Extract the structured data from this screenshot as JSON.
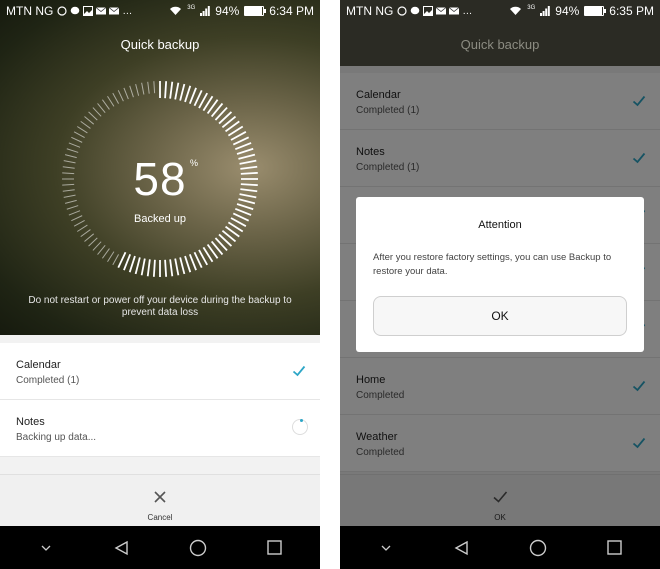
{
  "left": {
    "status": {
      "carrier": "MTN NG",
      "network": "3G",
      "battery": "94%",
      "battery_level": 0.94,
      "time": "6:34 PM"
    },
    "title": "Quick backup",
    "progress_value": "58",
    "progress_unit": "%",
    "progress_fraction": 0.58,
    "progress_label": "Backed up",
    "warning": "Do not restart or power off your device during the backup to prevent data loss",
    "items": [
      {
        "title": "Calendar",
        "status": "Completed (1)",
        "state": "done"
      },
      {
        "title": "Notes",
        "status": "Backing up data...",
        "state": "in-progress"
      }
    ],
    "bottom_action": {
      "label": "Cancel",
      "icon": "close-icon"
    }
  },
  "right": {
    "status": {
      "carrier": "MTN NG",
      "network": "3G",
      "battery": "94%",
      "battery_level": 0.94,
      "time": "6:35 PM"
    },
    "title": "Quick backup",
    "items": [
      {
        "title": "Calendar",
        "status": "Completed (1)"
      },
      {
        "title": "Notes",
        "status": "Completed (1)"
      },
      {
        "title": "",
        "status": ""
      },
      {
        "title": "",
        "status": ""
      },
      {
        "title": "",
        "status": ""
      },
      {
        "title": "Home",
        "status": "Completed"
      },
      {
        "title": "Weather",
        "status": "Completed"
      }
    ],
    "dialog": {
      "title": "Attention",
      "message": "After you restore factory settings, you can use Backup to restore your data.",
      "ok_label": "OK"
    },
    "bottom_action": {
      "label": "OK",
      "icon": "check-icon"
    }
  },
  "colors": {
    "accent": "#2da6c7",
    "navbar": "#000000"
  }
}
